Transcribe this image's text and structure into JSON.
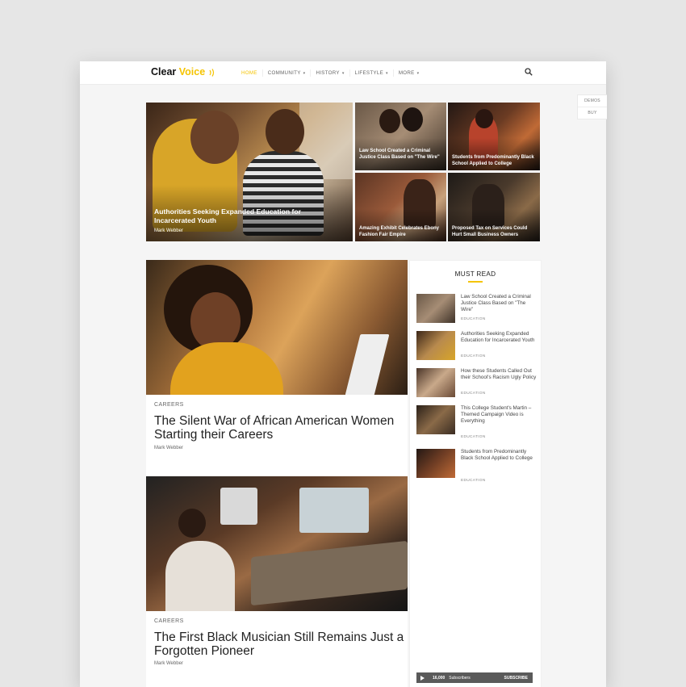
{
  "logo": {
    "part1": "Clear",
    "part2": "Voice"
  },
  "nav": [
    {
      "label": "HOME",
      "active": true,
      "has_menu": false
    },
    {
      "label": "COMMUNITY",
      "active": false,
      "has_menu": true
    },
    {
      "label": "HISTORY",
      "active": false,
      "has_menu": true
    },
    {
      "label": "LIFESTYLE",
      "active": false,
      "has_menu": true
    },
    {
      "label": "MORE",
      "active": false,
      "has_menu": true
    }
  ],
  "side_tabs": {
    "demos": "DEMOS",
    "buy": "BUY"
  },
  "hero": {
    "main": {
      "title": "Authorities Seeking Expanded Education for Incarcerated Youth",
      "author": "Mark Webber"
    },
    "small": [
      {
        "title": "Law School Created a Criminal Justice Class Based on \"The Wire\""
      },
      {
        "title": "Students from Predominantly Black School Applied to College"
      },
      {
        "title": "Amazing Exhibit Celebrates Ebony Fashion Fair Empire"
      },
      {
        "title": "Proposed Tax on Services Could Hurt Small Business Owners"
      }
    ]
  },
  "featured": [
    {
      "category": "CAREERS",
      "title": "The Silent War of African American Women Starting their Careers",
      "author": "Mark Webber"
    },
    {
      "category": "CAREERS",
      "title": "The First Black Musician Still Remains Just a Forgotten Pioneer",
      "author": "Mark Webber"
    }
  ],
  "must_read": {
    "title": "MUST READ",
    "items": [
      {
        "title": "Law School Created a Criminal Justice Class Based on \"The Wire\"",
        "category": "EDUCATION"
      },
      {
        "title": "Authorities Seeking Expanded Education for Incarcerated Youth",
        "category": "EDUCATION"
      },
      {
        "title": "How these Students Called Out their School's Racism Ugly Policy",
        "category": "EDUCATION"
      },
      {
        "title": "This College Student's Martin – Themed Campaign Video is Everything",
        "category": "EDUCATION"
      },
      {
        "title": "Students from Predominantly Black School Applied to College",
        "category": "EDUCATION"
      }
    ]
  },
  "subscribe": {
    "count": "16,000",
    "label": "Subscribers",
    "button": "SUBSCRIBE"
  },
  "colors": {
    "accent": "#f5c400",
    "text": "#222222",
    "background": "#f5f5f5"
  },
  "icons": {
    "search": "search-icon",
    "chevron": "chevron-down-icon",
    "play": "play-icon"
  }
}
